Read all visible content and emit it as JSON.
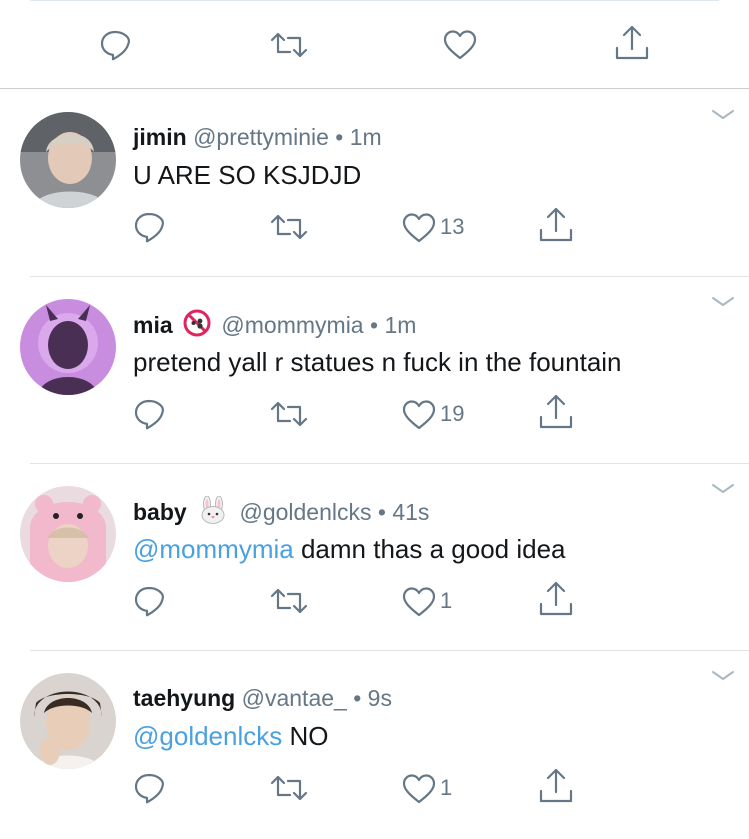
{
  "colors": {
    "mention": "#4aa1e2",
    "icon": "#657786",
    "text": "#14171a"
  },
  "top_actions": [
    "reply-icon",
    "retweet-icon",
    "like-icon",
    "share-icon"
  ],
  "tweets": [
    {
      "name": "jimin",
      "badge": "",
      "handle": "@prettyminie",
      "dot": "•",
      "time": "1m",
      "mention": "",
      "body": "U ARE SO KSJDJD",
      "likes": "13"
    },
    {
      "name": "mia",
      "badge": "no-under-18-icon",
      "handle": "@mommymia",
      "dot": "•",
      "time": "1m",
      "mention": "",
      "body": "pretend yall r statues n fuck in the fountain",
      "likes": "19"
    },
    {
      "name": "baby",
      "badge": "rabbit-face-icon",
      "handle": "@goldenlcks",
      "dot": "•",
      "time": "41s",
      "mention": "@mommymia",
      "body": "damn thas a good idea",
      "likes": "1"
    },
    {
      "name": "taehyung",
      "badge": "",
      "handle": "@vantae_",
      "dot": "•",
      "time": "9s",
      "mention": "@goldenlcks",
      "body": "NO",
      "likes": "1"
    }
  ]
}
